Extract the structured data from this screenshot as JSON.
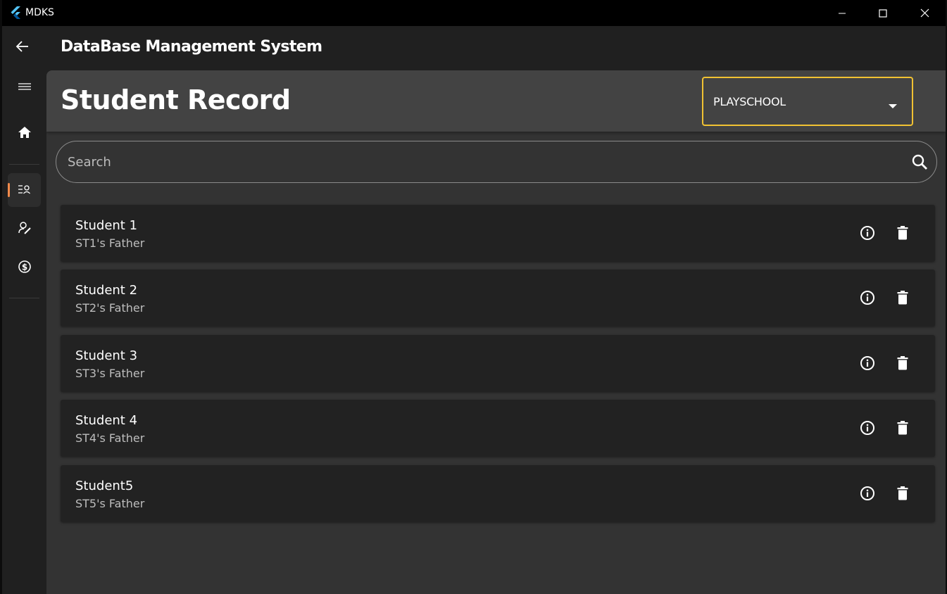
{
  "window": {
    "title": "MDKS",
    "controls": {
      "minimize_icon": "minimize-icon",
      "maximize_icon": "maximize-icon",
      "close_icon": "close-icon"
    }
  },
  "appbar": {
    "title": "DataBase Management System",
    "back_icon": "arrow-back-icon"
  },
  "rail": {
    "items": [
      {
        "icon": "menu-icon",
        "selected": false
      },
      {
        "icon": "home-icon",
        "selected": false
      },
      {
        "icon": "student-list-icon",
        "selected": true
      },
      {
        "icon": "person-edit-icon",
        "selected": false
      },
      {
        "icon": "dollar-icon",
        "selected": false
      }
    ],
    "accent_color": "#f08a4b"
  },
  "header": {
    "title": "Student Record",
    "dropdown": {
      "selected": "PLAYSCHOOL",
      "border_color": "#f1c232"
    }
  },
  "search": {
    "placeholder": "Search",
    "value": ""
  },
  "students": [
    {
      "name": "Student 1",
      "father": "ST1's Father"
    },
    {
      "name": "Student 2",
      "father": "ST2's Father"
    },
    {
      "name": "Student 3",
      "father": "ST3's Father"
    },
    {
      "name": "Student 4",
      "father": "ST4's Father"
    },
    {
      "name": "Student5",
      "father": "ST5's Father"
    }
  ]
}
